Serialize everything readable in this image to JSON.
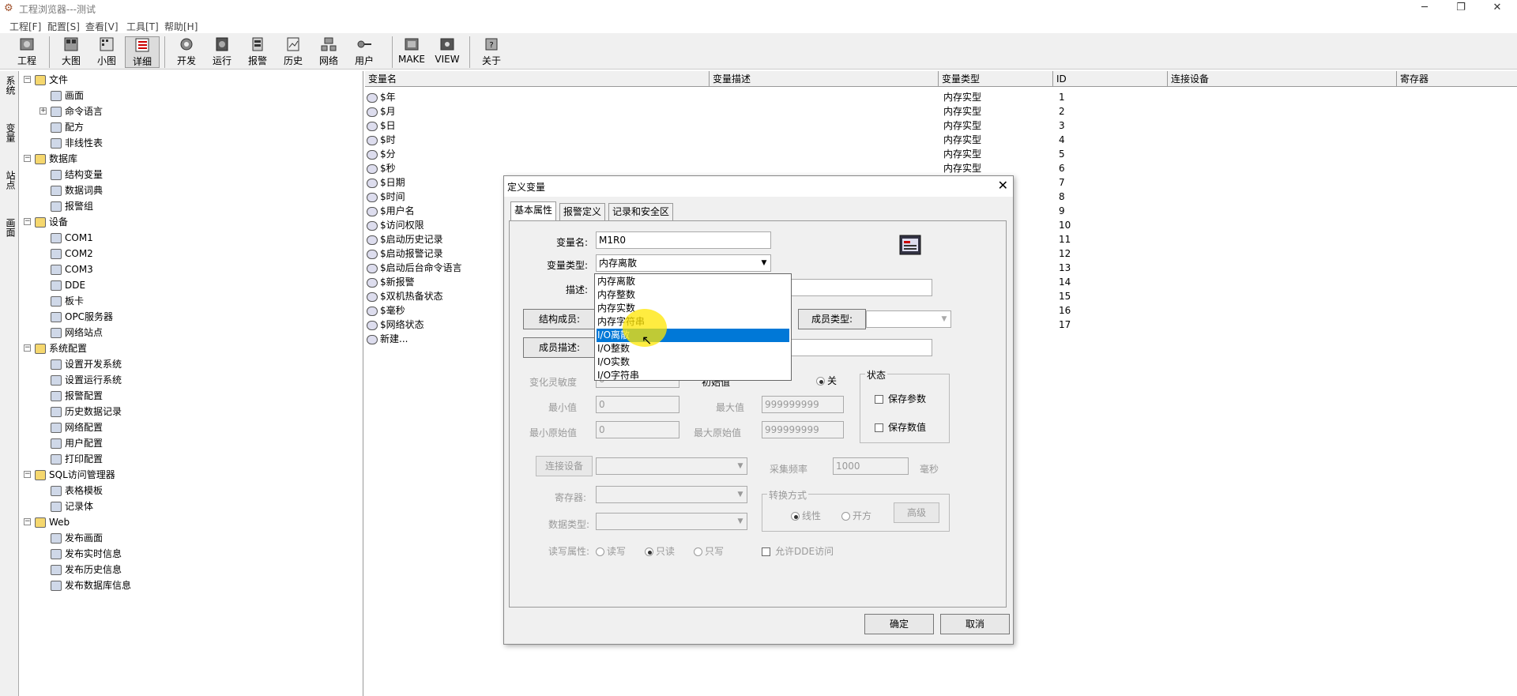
{
  "window": {
    "title": "工程浏览器---测试"
  },
  "menu": [
    "工程[F]",
    "配置[S]",
    "查看[V]",
    "工具[T]",
    "帮助[H]"
  ],
  "toolbar": [
    {
      "label": "工程",
      "icon": "project-icon"
    },
    {
      "label": "大图",
      "icon": "large-icons-icon"
    },
    {
      "label": "小图",
      "icon": "small-icons-icon"
    },
    {
      "label": "详细",
      "icon": "details-icon"
    },
    {
      "label": "开发",
      "icon": "develop-icon"
    },
    {
      "label": "运行",
      "icon": "run-icon"
    },
    {
      "label": "报警",
      "icon": "alarm-icon"
    },
    {
      "label": "历史",
      "icon": "history-icon"
    },
    {
      "label": "网络",
      "icon": "network-icon"
    },
    {
      "label": "用户",
      "icon": "user-icon"
    },
    {
      "label": "MAKE",
      "icon": "make-icon"
    },
    {
      "label": "VIEW",
      "icon": "view-icon"
    },
    {
      "label": "关于",
      "icon": "about-icon"
    }
  ],
  "left_tabs": [
    "系统",
    "变量",
    "站点",
    "画面"
  ],
  "tree": [
    {
      "label": "文件",
      "level": 0,
      "expander": "−"
    },
    {
      "label": "画面",
      "level": 1
    },
    {
      "label": "命令语言",
      "level": 1,
      "expander": "+"
    },
    {
      "label": "配方",
      "level": 1
    },
    {
      "label": "非线性表",
      "level": 1
    },
    {
      "label": "数据库",
      "level": 0,
      "expander": "−"
    },
    {
      "label": "结构变量",
      "level": 1
    },
    {
      "label": "数据词典",
      "level": 1
    },
    {
      "label": "报警组",
      "level": 1
    },
    {
      "label": "设备",
      "level": 0,
      "expander": "−"
    },
    {
      "label": "COM1",
      "level": 1
    },
    {
      "label": "COM2",
      "level": 1
    },
    {
      "label": "COM3",
      "level": 1
    },
    {
      "label": "DDE",
      "level": 1
    },
    {
      "label": "板卡",
      "level": 1
    },
    {
      "label": "OPC服务器",
      "level": 1
    },
    {
      "label": "网络站点",
      "level": 1
    },
    {
      "label": "系统配置",
      "level": 0,
      "expander": "−"
    },
    {
      "label": "设置开发系统",
      "level": 1
    },
    {
      "label": "设置运行系统",
      "level": 1
    },
    {
      "label": "报警配置",
      "level": 1
    },
    {
      "label": "历史数据记录",
      "level": 1
    },
    {
      "label": "网络配置",
      "level": 1
    },
    {
      "label": "用户配置",
      "level": 1
    },
    {
      "label": "打印配置",
      "level": 1
    },
    {
      "label": "SQL访问管理器",
      "level": 0,
      "expander": "−"
    },
    {
      "label": "表格模板",
      "level": 1
    },
    {
      "label": "记录体",
      "level": 1
    },
    {
      "label": "Web",
      "level": 0,
      "expander": "−"
    },
    {
      "label": "发布画面",
      "level": 1
    },
    {
      "label": "发布实时信息",
      "level": 1
    },
    {
      "label": "发布历史信息",
      "level": 1
    },
    {
      "label": "发布数据库信息",
      "level": 1
    }
  ],
  "table": {
    "columns": [
      "变量名",
      "变量描述",
      "变量类型",
      "ID",
      "连接设备",
      "寄存器"
    ],
    "rows": [
      {
        "name": "$年",
        "type": "内存实型",
        "id": "1"
      },
      {
        "name": "$月",
        "type": "内存实型",
        "id": "2"
      },
      {
        "name": "$日",
        "type": "内存实型",
        "id": "3"
      },
      {
        "name": "$时",
        "type": "内存实型",
        "id": "4"
      },
      {
        "name": "$分",
        "type": "内存实型",
        "id": "5"
      },
      {
        "name": "$秒",
        "type": "内存实型",
        "id": "6"
      },
      {
        "name": "$日期",
        "type": "",
        "id": "7"
      },
      {
        "name": "$时间",
        "type": "",
        "id": "8"
      },
      {
        "name": "$用户名",
        "type": "",
        "id": "9"
      },
      {
        "name": "$访问权限",
        "type": "",
        "id": "10"
      },
      {
        "name": "$启动历史记录",
        "type": "",
        "id": "11"
      },
      {
        "name": "$启动报警记录",
        "type": "",
        "id": "12"
      },
      {
        "name": "$启动后台命令语言",
        "type": "",
        "id": "13"
      },
      {
        "name": "$新报警",
        "type": "",
        "id": "14"
      },
      {
        "name": "$双机热备状态",
        "type": "",
        "id": "15"
      },
      {
        "name": "$毫秒",
        "type": "",
        "id": "16"
      },
      {
        "name": "$网络状态",
        "type": "",
        "id": "17"
      },
      {
        "name": "新建...",
        "type": "",
        "id": ""
      }
    ]
  },
  "dialog": {
    "title": "定义变量",
    "tabs": [
      "基本属性",
      "报警定义",
      "记录和安全区"
    ],
    "var_name_label": "变量名:",
    "var_name_value": "M1R0",
    "var_type_label": "变量类型:",
    "var_type_value": "内存离散",
    "desc_label": "描述:",
    "struct_member_btn": "结构成员:",
    "member_type_label": "成员类型:",
    "member_desc_btn": "成员描述:",
    "sensitivity_label": "变化灵敏度",
    "sensitivity_value": "0",
    "init_label": "初始值",
    "off_label": "关",
    "state_group": "状态",
    "save_param": "保存参数",
    "save_value": "保存数值",
    "min_label": "最小值",
    "min_value": "0",
    "max_label": "最大值",
    "max_value": "999999999",
    "min_raw_label": "最小原始值",
    "min_raw_value": "0",
    "max_raw_label": "最大原始值",
    "max_raw_value": "999999999",
    "device_btn": "连接设备",
    "freq_label": "采集频率",
    "freq_value": "1000",
    "ms_label": "毫秒",
    "register_label": "寄存器:",
    "convert_group": "转换方式",
    "linear": "线性",
    "sqrt": "开方",
    "advanced_btn": "高级",
    "datatype_label": "数据类型:",
    "rw_label": "读写属性:",
    "rw_options": [
      "读写",
      "只读",
      "只写"
    ],
    "dde_label": "允许DDE访问",
    "ok": "确定",
    "cancel": "取消",
    "type_options": [
      "内存离散",
      "内存整数",
      "内存实数",
      "内存字符串",
      "I/O离散",
      "I/O整数",
      "I/O实数",
      "I/O字符串"
    ],
    "selected_option": "I/O离散"
  },
  "colors": {
    "selection": "#0078d7",
    "cursor_highlight": "#ffe600"
  }
}
